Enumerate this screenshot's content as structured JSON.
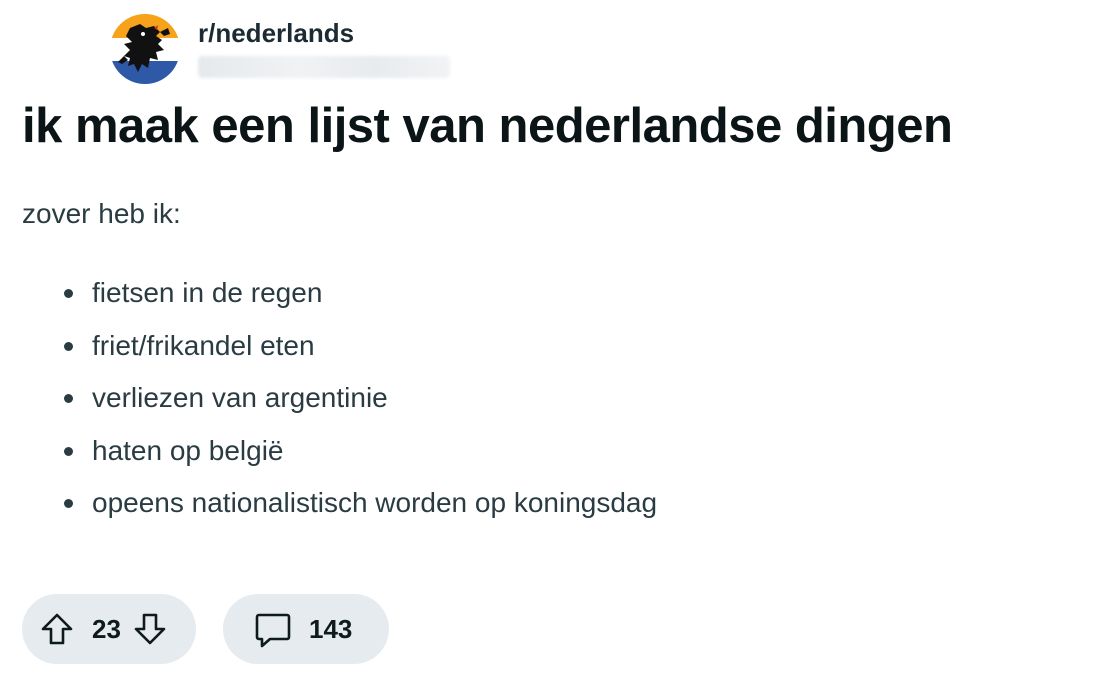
{
  "post": {
    "subreddit": "r/nederlands",
    "username": "",
    "title": "ik maak een lijst van nederlandse dingen",
    "intro": "zover heb ik:",
    "items": [
      "fietsen in de regen",
      "friet/frikandel eten",
      "verliezen van argentinie",
      "haten op belgië",
      "opeens nationalistisch worden op koningsdag"
    ]
  },
  "actions": {
    "vote_count": "23",
    "comment_count": "143"
  },
  "icons": {
    "avatar": "subreddit-flag-lion-icon",
    "upvote": "arrow-up-icon",
    "downvote": "arrow-down-icon",
    "comments": "speech-bubble-icon"
  },
  "colors": {
    "flag_orange": "#f6a21a",
    "flag_white": "#ffffff",
    "flag_blue": "#2d59a6",
    "pill_background": "#e5ebee",
    "title_text": "#0b1416",
    "body_text": "#2a3c42"
  }
}
